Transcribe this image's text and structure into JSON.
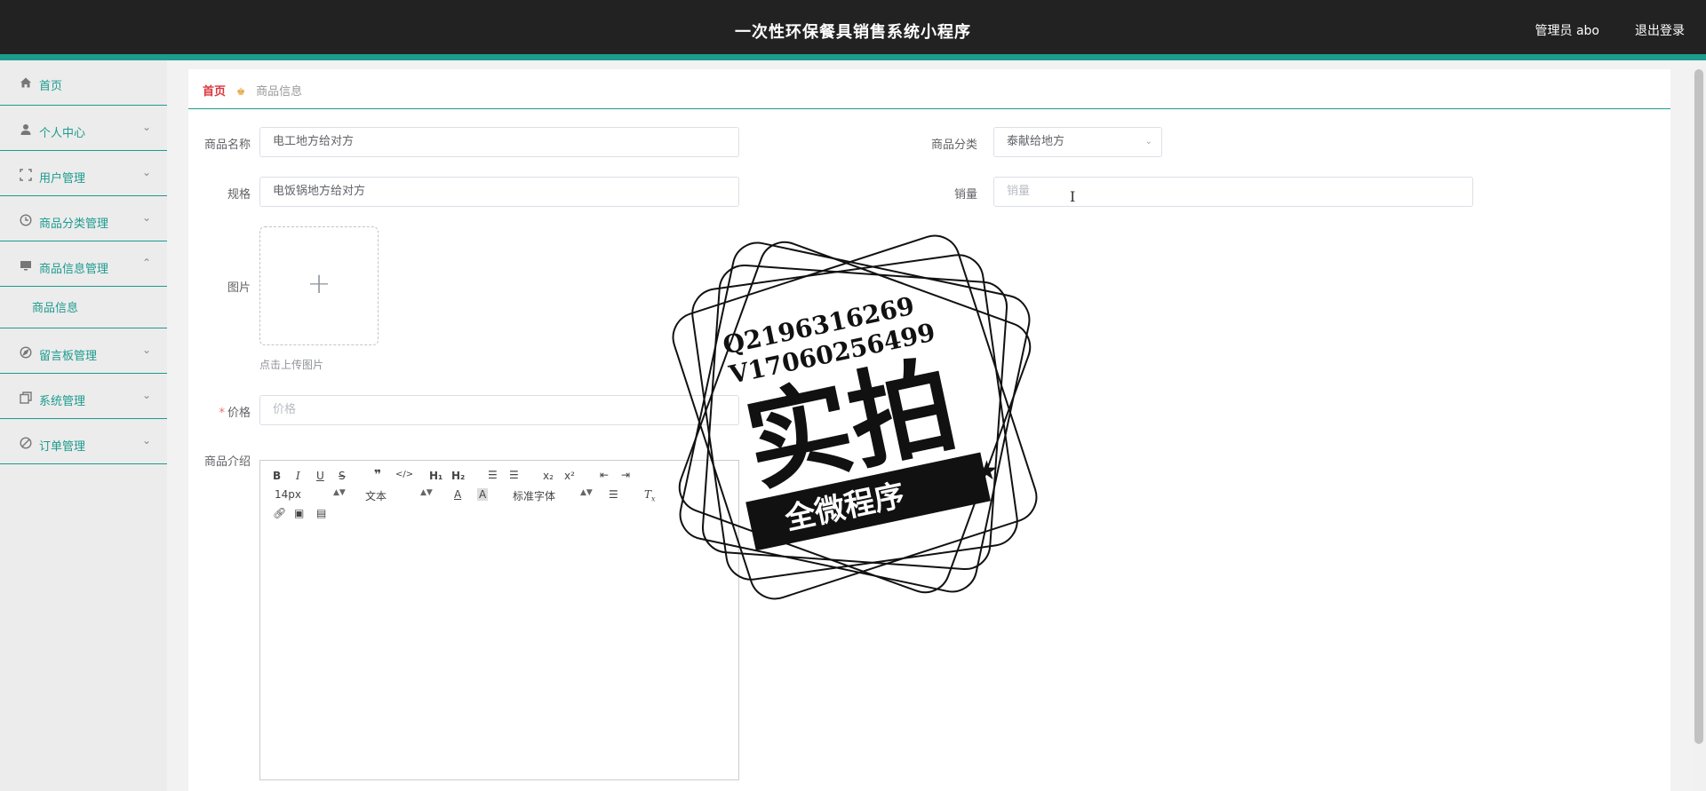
{
  "header": {
    "title": "一次性环保餐具销售系统小程序",
    "user": "管理员 abo",
    "logout": "退出登录"
  },
  "sidebar": {
    "items": [
      {
        "label": "首页",
        "icon": "home-icon"
      },
      {
        "label": "个人中心",
        "icon": "user-icon"
      },
      {
        "label": "用户管理",
        "icon": "fullscreen-icon"
      },
      {
        "label": "商品分类管理",
        "icon": "clock-icon"
      },
      {
        "label": "商品信息管理",
        "icon": "monitor-icon"
      },
      {
        "label": "留言板管理",
        "icon": "compass-icon"
      },
      {
        "label": "系统管理",
        "icon": "copy-icon"
      },
      {
        "label": "订单管理",
        "icon": "discount-icon"
      }
    ],
    "submenu": {
      "label": "商品信息"
    }
  },
  "breadcrumb": {
    "home": "首页",
    "current": "商品信息"
  },
  "form": {
    "name_label": "商品名称",
    "name_value": "电工地方给对方",
    "category_label": "商品分类",
    "category_value": "泰献给地方",
    "spec_label": "规格",
    "spec_value": "电饭锅地方给对方",
    "sales_label": "销量",
    "sales_placeholder": "销量",
    "image_label": "图片",
    "upload_tip": "点击上传图片",
    "price_label": "价格",
    "price_placeholder": "价格",
    "intro_label": "商品介绍"
  },
  "editor": {
    "font_size": "14px",
    "header_picker": "文本",
    "font_picker": "标准字体"
  },
  "stamp": {
    "line1": "Q2196316269",
    "line2": "V17060256499",
    "big": "实拍",
    "banner": "全微程序"
  },
  "colors": {
    "accent": "#1c9b8e",
    "topbar": "#222222",
    "breadcrumb_home": "#d9363e"
  }
}
